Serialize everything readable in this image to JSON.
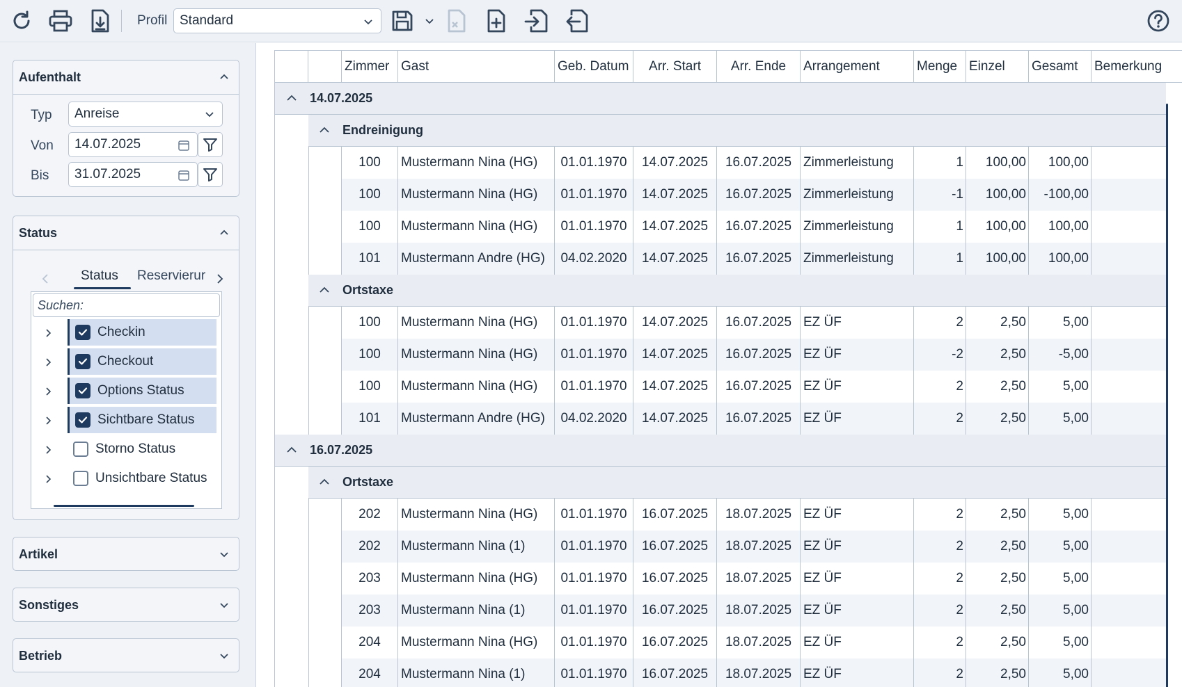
{
  "toolbar": {
    "icons": [
      "refresh-icon",
      "print-icon",
      "download-icon",
      "save-icon",
      "chevron-down-icon",
      "delete-file-icon",
      "new-file-icon",
      "import-icon",
      "export-icon",
      "help-icon"
    ],
    "profil_label": "Profil",
    "profil_value": "Standard"
  },
  "sidebar": {
    "aufenthalt": {
      "title": "Aufenthalt",
      "typ_label": "Typ",
      "typ_value": "Anreise",
      "von_label": "Von",
      "von_value": "14.07.2025",
      "bis_label": "Bis",
      "bis_value": "31.07.2025"
    },
    "status": {
      "title": "Status",
      "tab_status": "Status",
      "tab_reservierung": "Reservierur",
      "search_placeholder": "Suchen:",
      "items": [
        {
          "label": "Checkin",
          "checked": true
        },
        {
          "label": "Checkout",
          "checked": true
        },
        {
          "label": "Options Status",
          "checked": true
        },
        {
          "label": "Sichtbare Status",
          "checked": true
        },
        {
          "label": "Storno Status",
          "checked": false
        },
        {
          "label": "Unsichtbare Status",
          "checked": false
        }
      ]
    },
    "artikel": {
      "title": "Artikel"
    },
    "sonstiges": {
      "title": "Sonstiges"
    },
    "betrieb": {
      "title": "Betrieb"
    }
  },
  "grid": {
    "columns": [
      "Zimmer",
      "Gast",
      "Geb. Datum",
      "Arr. Start",
      "Arr. Ende",
      "Arrangement",
      "Menge",
      "Einzel",
      "Gesamt",
      "Bemerkung"
    ],
    "groups": [
      {
        "date": "14.07.2025",
        "subgroups": [
          {
            "name": "Endreinigung",
            "rows": [
              [
                "100",
                "Mustermann Nina (HG)",
                "01.01.1970",
                "14.07.2025",
                "16.07.2025",
                "Zimmerleistung",
                "1",
                "100,00",
                "100,00",
                ""
              ],
              [
                "100",
                "Mustermann Nina (HG)",
                "01.01.1970",
                "14.07.2025",
                "16.07.2025",
                "Zimmerleistung",
                "-1",
                "100,00",
                "-100,00",
                ""
              ],
              [
                "100",
                "Mustermann Nina (HG)",
                "01.01.1970",
                "14.07.2025",
                "16.07.2025",
                "Zimmerleistung",
                "1",
                "100,00",
                "100,00",
                ""
              ],
              [
                "101",
                "Mustermann Andre (HG)",
                "04.02.2020",
                "14.07.2025",
                "16.07.2025",
                "Zimmerleistung",
                "1",
                "100,00",
                "100,00",
                ""
              ]
            ]
          },
          {
            "name": "Ortstaxe",
            "rows": [
              [
                "100",
                "Mustermann Nina (HG)",
                "01.01.1970",
                "14.07.2025",
                "16.07.2025",
                "EZ ÜF",
                "2",
                "2,50",
                "5,00",
                ""
              ],
              [
                "100",
                "Mustermann Nina (HG)",
                "01.01.1970",
                "14.07.2025",
                "16.07.2025",
                "EZ ÜF",
                "-2",
                "2,50",
                "-5,00",
                ""
              ],
              [
                "100",
                "Mustermann Nina (HG)",
                "01.01.1970",
                "14.07.2025",
                "16.07.2025",
                "EZ ÜF",
                "2",
                "2,50",
                "5,00",
                ""
              ],
              [
                "101",
                "Mustermann Andre (HG)",
                "04.02.2020",
                "14.07.2025",
                "16.07.2025",
                "EZ ÜF",
                "2",
                "2,50",
                "5,00",
                ""
              ]
            ]
          }
        ]
      },
      {
        "date": "16.07.2025",
        "subgroups": [
          {
            "name": "Ortstaxe",
            "rows": [
              [
                "202",
                "Mustermann Nina (HG)",
                "01.01.1970",
                "16.07.2025",
                "18.07.2025",
                "EZ ÜF",
                "2",
                "2,50",
                "5,00",
                ""
              ],
              [
                "202",
                "Mustermann Nina (1)",
                "01.01.1970",
                "16.07.2025",
                "18.07.2025",
                "EZ ÜF",
                "2",
                "2,50",
                "5,00",
                ""
              ],
              [
                "203",
                "Mustermann Nina (HG)",
                "01.01.1970",
                "16.07.2025",
                "18.07.2025",
                "EZ ÜF",
                "2",
                "2,50",
                "5,00",
                ""
              ],
              [
                "203",
                "Mustermann Nina (1)",
                "01.01.1970",
                "16.07.2025",
                "18.07.2025",
                "EZ ÜF",
                "2",
                "2,50",
                "5,00",
                ""
              ],
              [
                "204",
                "Mustermann Nina (HG)",
                "01.01.1970",
                "16.07.2025",
                "18.07.2025",
                "EZ ÜF",
                "2",
                "2,50",
                "5,00",
                ""
              ],
              [
                "204",
                "Mustermann Nina (1)",
                "01.01.1970",
                "16.07.2025",
                "18.07.2025",
                "EZ ÜF",
                "2",
                "2,50",
                "5,00",
                ""
              ]
            ]
          }
        ]
      }
    ]
  }
}
